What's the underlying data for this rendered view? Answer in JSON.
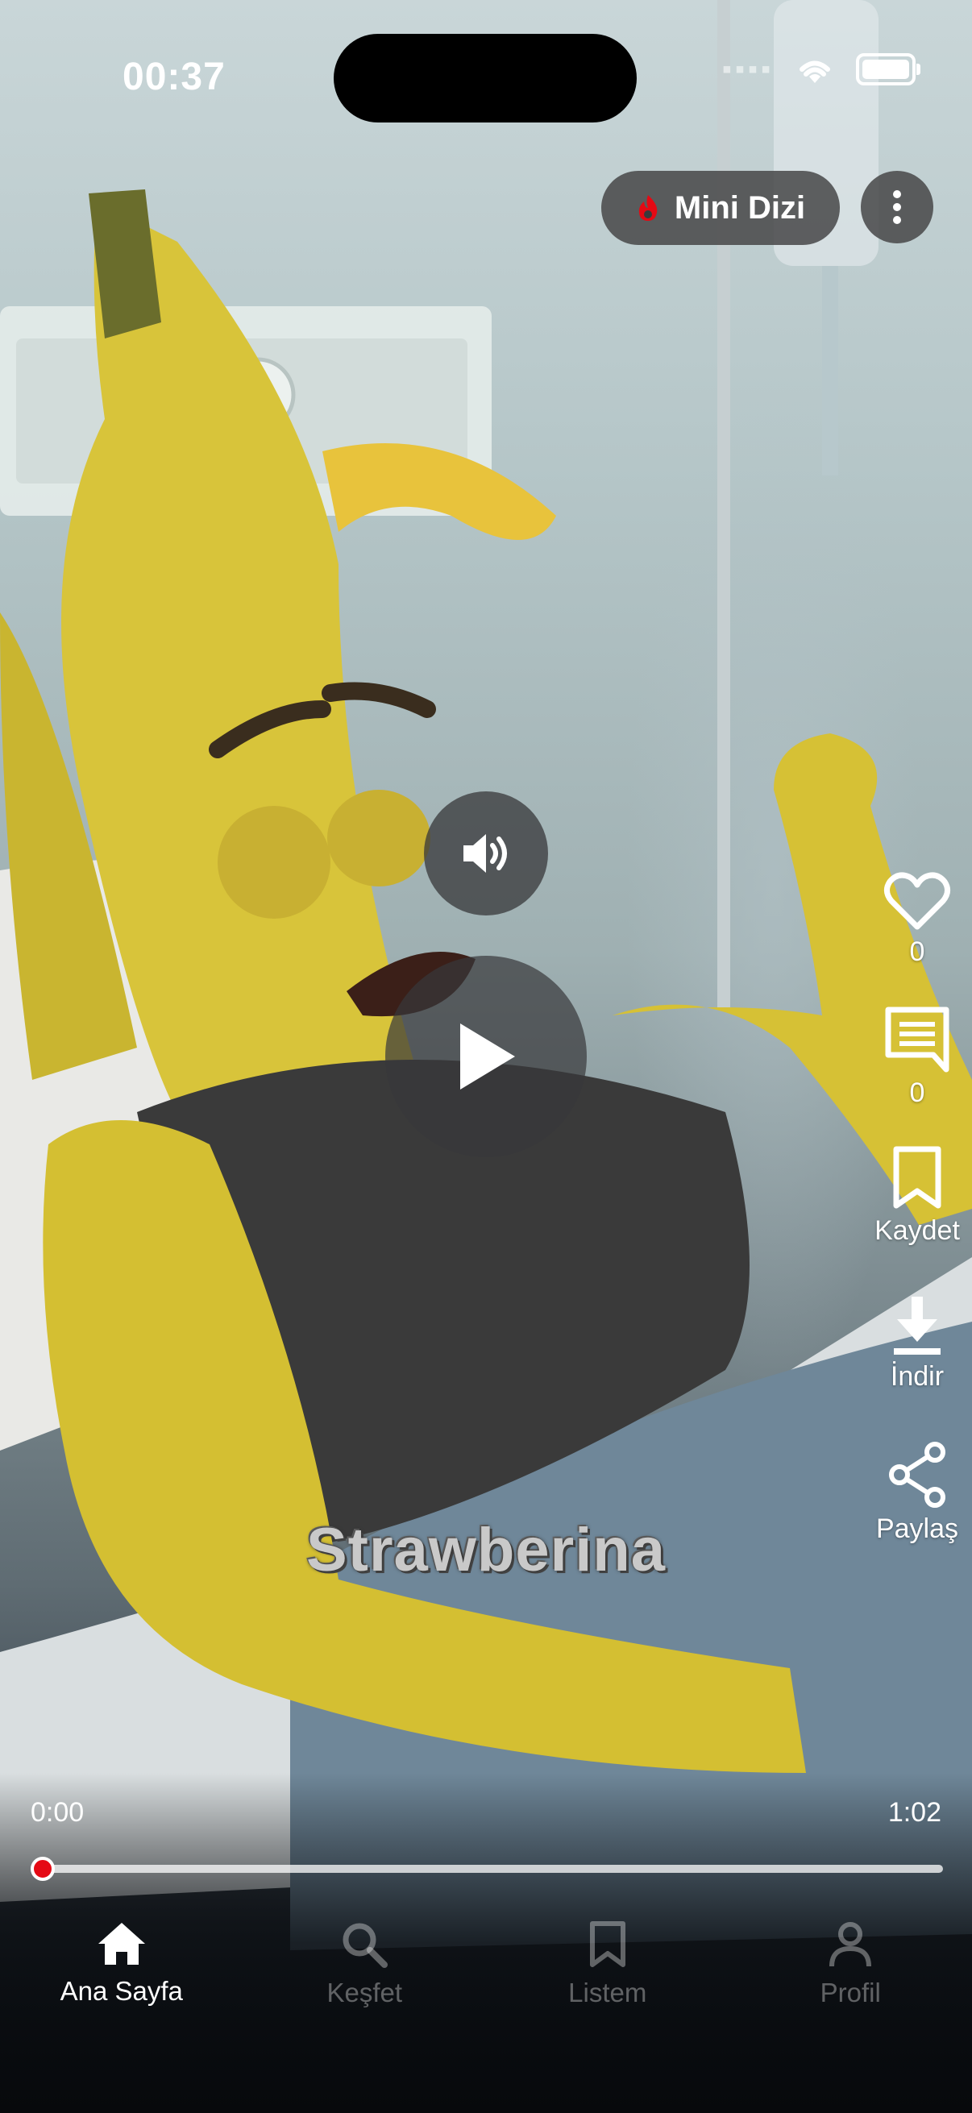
{
  "status_bar": {
    "time": "00:37"
  },
  "top": {
    "badge_label": "Mini Dizi",
    "badge_icon": "fire-icon",
    "menu_icon": "more-vertical-icon"
  },
  "player": {
    "sound_icon": "volume-icon",
    "play_icon": "play-icon",
    "subtitle": "Strawberina",
    "current_time": "0:00",
    "duration": "1:02",
    "progress": 0.0
  },
  "actions": {
    "like": {
      "icon": "heart-icon",
      "count": "0"
    },
    "comment": {
      "icon": "comment-icon",
      "count": "0"
    },
    "save": {
      "icon": "bookmark-icon",
      "label": "Kaydet"
    },
    "download": {
      "icon": "download-icon",
      "label": "İndir"
    },
    "share": {
      "icon": "share-icon",
      "label": "Paylaş"
    }
  },
  "nav": [
    {
      "label": "Ana Sayfa",
      "icon": "home-icon",
      "active": true
    },
    {
      "label": "Keşfet",
      "icon": "search-icon",
      "active": false
    },
    {
      "label": "Listem",
      "icon": "bookmark-icon",
      "active": false
    },
    {
      "label": "Profil",
      "icon": "person-icon",
      "active": false
    }
  ],
  "colors": {
    "accent": "#e50914"
  }
}
